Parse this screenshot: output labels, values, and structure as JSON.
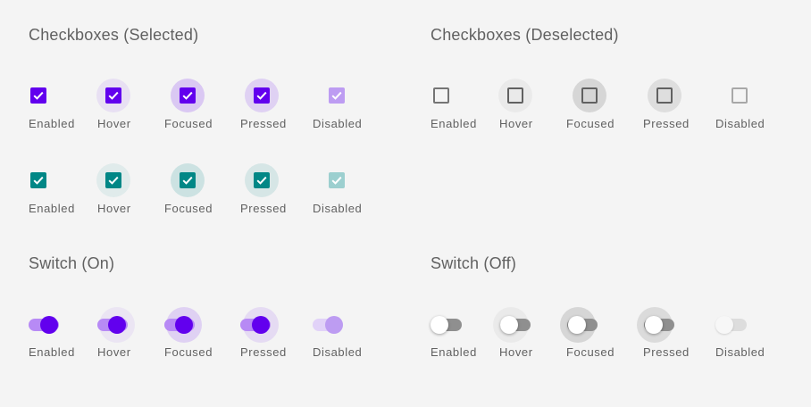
{
  "sections": {
    "cb_selected": "Checkboxes (Selected)",
    "cb_deselected": "Checkboxes (Deselected)",
    "sw_on": "Switch (On)",
    "sw_off": "Switch (Off)"
  },
  "states": [
    "Enabled",
    "Hover",
    "Focused",
    "Pressed",
    "Disabled"
  ],
  "colors": {
    "background": "#f4f4f4",
    "primary": "#6200ee",
    "primary_disabled": "#bd9cf2",
    "secondary": "#018786",
    "secondary_disabled": "#9ccfcf",
    "label": "#616161",
    "unchecked": "#757575"
  }
}
